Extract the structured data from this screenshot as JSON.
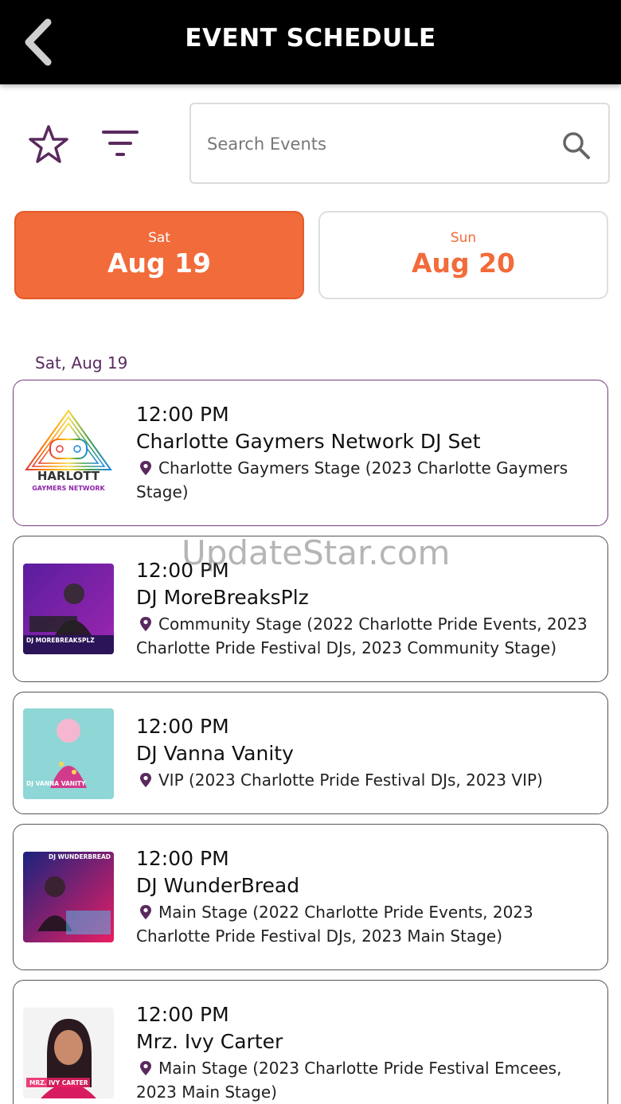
{
  "header": {
    "title": "EVENT SCHEDULE"
  },
  "search": {
    "placeholder": "Search Events"
  },
  "dates": [
    {
      "dow": "Sat",
      "day": "Aug 19",
      "selected": true
    },
    {
      "dow": "Sun",
      "day": "Aug 20",
      "selected": false
    }
  ],
  "section": {
    "label": "Sat, Aug 19"
  },
  "events": [
    {
      "time": "12:00 PM",
      "name": "Charlotte Gaymers Network DJ Set",
      "location": "Charlotte Gaymers Stage (2023 Charlotte Gaymers Stage)",
      "thumb_text": [
        "HARLOTT",
        "GAYMERS NETWORK"
      ]
    },
    {
      "time": "12:00 PM",
      "name": "DJ MoreBreaksPlz",
      "location": "Community Stage (2022 Charlotte Pride Events, 2023 Charlotte Pride Festival DJs, 2023 Community Stage)",
      "thumb_text": [
        "DJ MOREBREAKSPLZ"
      ]
    },
    {
      "time": "12:00 PM",
      "name": "DJ Vanna Vanity",
      "location": "VIP (2023 Charlotte Pride Festival DJs, 2023 VIP)",
      "thumb_text": [
        "DJ VANNA VANITY"
      ]
    },
    {
      "time": "12:00 PM",
      "name": "DJ WunderBread",
      "location": "Main Stage (2022 Charlotte Pride Events, 2023 Charlotte Pride Festival DJs, 2023 Main Stage)",
      "thumb_text": [
        "DJ WUNDERBREAD"
      ]
    },
    {
      "time": "12:00 PM",
      "name": "Mrz. Ivy Carter",
      "location": "Main Stage (2023 Charlotte Pride Festival Emcees, 2023 Main Stage)",
      "thumb_text": [
        "MRZ. IVY CARTER"
      ]
    }
  ],
  "watermark": "UpdateStar.com",
  "colors": {
    "accent": "#f26b3a",
    "purple": "#5a2a5e",
    "header_bg": "#000000"
  }
}
